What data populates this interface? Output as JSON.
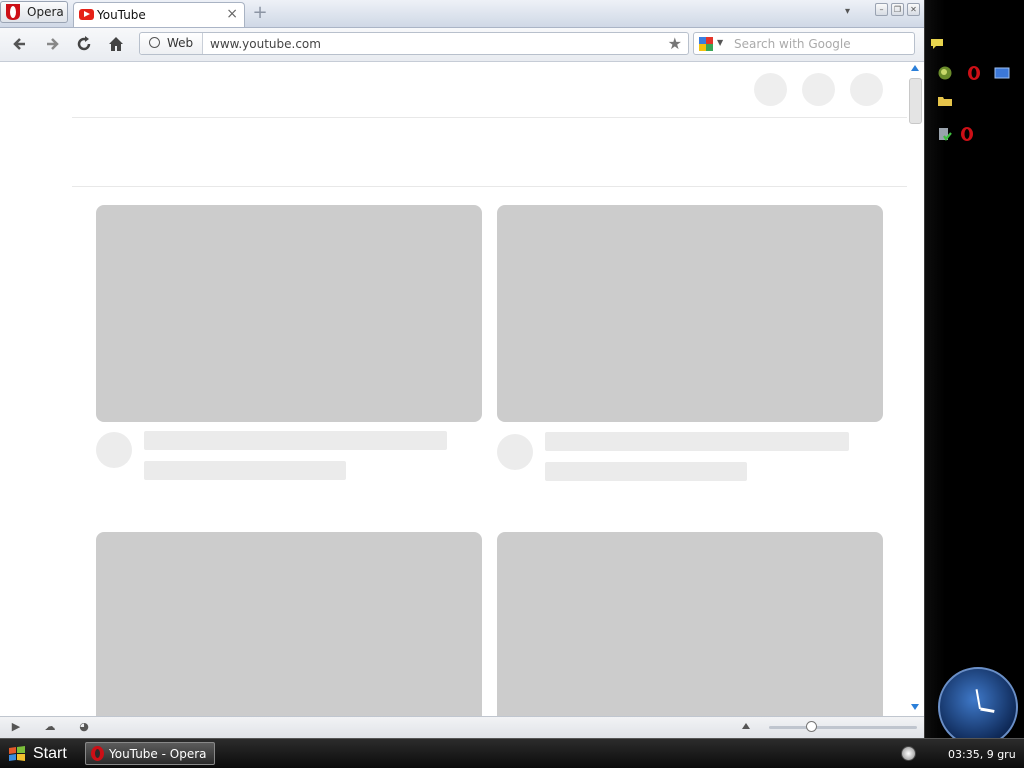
{
  "browser": {
    "menu_label": "Opera",
    "tabs": [
      {
        "label": "YouTube",
        "close": "×"
      }
    ],
    "new_tab": "+",
    "address": {
      "badge_label": "Web",
      "url": "www.youtube.com"
    },
    "search": {
      "placeholder": "Search with Google"
    }
  },
  "taskbar": {
    "start_label": "Start",
    "tasks": [
      {
        "label": "YouTube - Opera"
      }
    ],
    "clock_text": "03:35, 9 gru"
  },
  "icons": [
    "opera-logo-icon",
    "back-arrow-icon",
    "forward-arrow-icon",
    "reload-icon",
    "home-icon",
    "globe-icon",
    "bookmark-star-icon",
    "google-search-icon",
    "dropdown-arrow-icon",
    "panel-toggle-icon",
    "cloud-icon",
    "speed-dial-icon",
    "windows-flag-icon",
    "analog-clock-icon"
  ],
  "colors": {
    "youtube_red": "#e62117",
    "opera_red": "#cc0f16",
    "placeholder_gray": "#cccccc",
    "scroll_arrow_blue": "#2b7fd9"
  }
}
